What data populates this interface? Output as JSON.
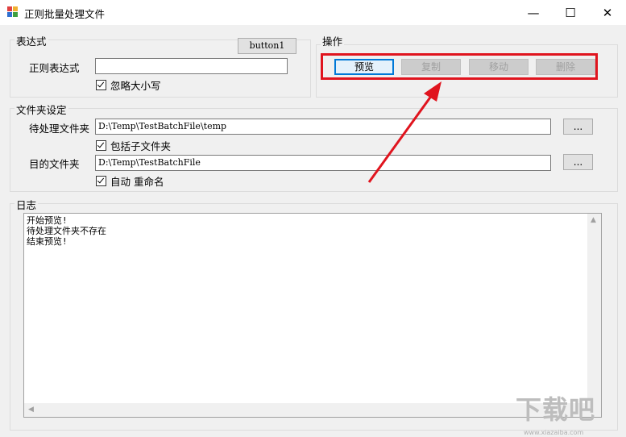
{
  "window": {
    "title": "正则批量处理文件",
    "controls": {
      "minimize": "—",
      "maximize": "☐",
      "close": "✕"
    }
  },
  "expression_group": {
    "title": "表达式",
    "button1_label": "button1",
    "regex_label": "正则表达式",
    "regex_value": "",
    "ignore_case_label": "忽略大小写",
    "ignore_case_checked": true
  },
  "operation_group": {
    "title": "操作",
    "buttons": {
      "preview": "预览",
      "copy": "复制",
      "move": "移动",
      "delete": "删除"
    }
  },
  "folder_group": {
    "title": "文件夹设定",
    "source_label": "待处理文件夹",
    "source_value": "D:\\Temp\\TestBatchFile\\temp",
    "source_browse": "...",
    "include_sub_label": "包括子文件夹",
    "target_label": "目的文件夹",
    "target_value": "D:\\Temp\\TestBatchFile",
    "target_browse": "...",
    "auto_rename_label": "自动 重命名"
  },
  "log_group": {
    "title": "日志",
    "lines": [
      "开始预览!",
      "待处理文件夹不存在",
      "结束预览!"
    ]
  },
  "colors": {
    "highlight": "#e0141e",
    "primary_border": "#0078d7"
  },
  "watermark": {
    "text": "下载吧",
    "sub": "www.xiazaiba.com"
  }
}
